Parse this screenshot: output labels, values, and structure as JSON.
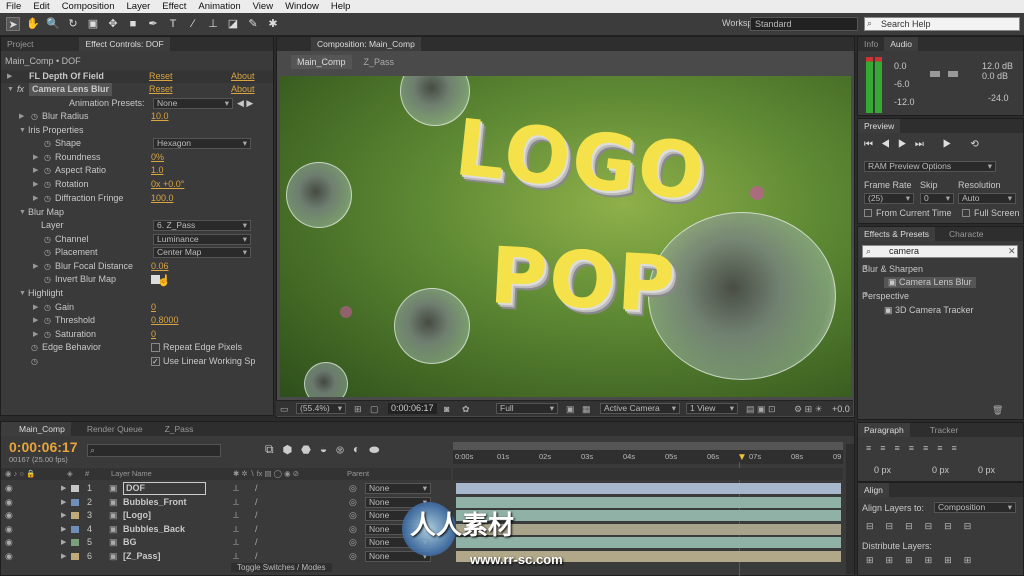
{
  "menu": [
    "File",
    "Edit",
    "Composition",
    "Layer",
    "Effect",
    "Animation",
    "View",
    "Window",
    "Help"
  ],
  "workspace": {
    "label": "Workspace:",
    "value": "Standard"
  },
  "search_help": "Search Help",
  "left_panel": {
    "tabs": [
      "Project",
      "Effect Controls: DOF"
    ],
    "breadcrumb": "Main_Comp • DOF",
    "effects": [
      {
        "name": "FL Depth Of Field",
        "reset": "Reset",
        "about": "About"
      },
      {
        "name": "Camera Lens Blur",
        "reset": "Reset",
        "about": "About"
      }
    ],
    "anim_presets": {
      "label": "Animation Presets:",
      "value": "None"
    },
    "props": {
      "blur_radius": {
        "label": "Blur Radius",
        "value": "10.0"
      },
      "iris": "Iris Properties",
      "shape": {
        "label": "Shape",
        "value": "Hexagon"
      },
      "roundness": {
        "label": "Roundness",
        "value": "0%"
      },
      "aspect": {
        "label": "Aspect Ratio",
        "value": "1.0"
      },
      "rotation": {
        "label": "Rotation",
        "value": "0x +0.0°"
      },
      "diffraction": {
        "label": "Diffraction Fringe",
        "value": "100.0"
      },
      "blur_map": "Blur Map",
      "layer": {
        "label": "Layer",
        "value": "6. Z_Pass"
      },
      "channel": {
        "label": "Channel",
        "value": "Luminance"
      },
      "placement": {
        "label": "Placement",
        "value": "Center Map"
      },
      "focal": {
        "label": "Blur Focal Distance",
        "value": "0.06"
      },
      "invert": {
        "label": "Invert Blur Map"
      },
      "highlight": "Highlight",
      "gain": {
        "label": "Gain",
        "value": "0"
      },
      "threshold": {
        "label": "Threshold",
        "value": "0.8000"
      },
      "saturation": {
        "label": "Saturation",
        "value": "0"
      },
      "edge": {
        "label": "Edge Behavior",
        "check": "Repeat Edge Pixels"
      },
      "linear": "Use Linear Working Sp"
    }
  },
  "comp_panel": {
    "tab": "Composition: Main_Comp",
    "subtabs": [
      "Main_Comp",
      "Z_Pass"
    ],
    "logo_top": "LOGO",
    "logo_bottom": "POP",
    "controls": {
      "zoom": "(55.4%)",
      "time": "0:00:06:17",
      "res": "Full",
      "camera": "Active Camera",
      "view": "1 View",
      "exposure": "+0.0"
    }
  },
  "right_panels": {
    "audio_tabs": [
      "Info",
      "Audio"
    ],
    "db_left": [
      "0.0",
      "-6.0",
      "-12.0"
    ],
    "db_right": [
      "12.0 dB",
      "0.0 dB",
      "-24.0"
    ],
    "preview_tab": "Preview",
    "ram_preview": "RAM Preview Options",
    "frame_rate": {
      "label": "Frame Rate",
      "value": "(25)"
    },
    "skip": {
      "label": "Skip",
      "value": "0"
    },
    "resolution": {
      "label": "Resolution",
      "value": "Auto"
    },
    "from_current": "From Current Time",
    "full_screen": "Full Screen",
    "effects_tabs": [
      "Effects & Presets",
      "Characte"
    ],
    "effects_search": "camera",
    "tree": [
      "Blur & Sharpen",
      "Camera Lens Blur",
      "Perspective",
      "3D Camera Tracker"
    ],
    "paragraph_tabs": [
      "Paragraph",
      "Tracker"
    ],
    "px_values": [
      "0 px",
      "0 px",
      "0 px",
      "0 px",
      "0 px"
    ],
    "align_tab": "Align",
    "align_to": {
      "label": "Align Layers to:",
      "value": "Composition"
    },
    "distribute": "Distribute Layers:"
  },
  "timeline": {
    "tabs": [
      "Main_Comp",
      "Render Queue",
      "Z_Pass"
    ],
    "timecode": "0:00:06:17",
    "frames": "00167 (25.00 fps)",
    "header": {
      "layer_name": "Layer Name",
      "parent": "Parent"
    },
    "layers": [
      {
        "num": "1",
        "name": "DOF",
        "parent": "None"
      },
      {
        "num": "2",
        "name": "Bubbles_Front",
        "parent": "None"
      },
      {
        "num": "3",
        "name": "[Logo]",
        "parent": "None"
      },
      {
        "num": "4",
        "name": "Bubbles_Back",
        "parent": "None"
      },
      {
        "num": "5",
        "name": "BG",
        "parent": "None"
      },
      {
        "num": "6",
        "name": "[Z_Pass]",
        "parent": "None"
      }
    ],
    "ruler": [
      "0:00s",
      "01s",
      "02s",
      "03s",
      "04s",
      "05s",
      "06s",
      "07s",
      "08s",
      "09"
    ],
    "toggle": "Toggle Switches / Modes"
  },
  "watermark": {
    "cn": "人人素材",
    "url": "www.rr-sc.com"
  }
}
